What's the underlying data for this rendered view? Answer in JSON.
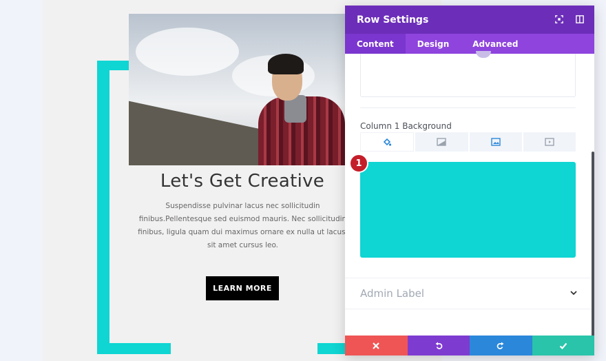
{
  "page": {
    "headline": "Let's Get Creative",
    "body_text": "Suspendisse pulvinar lacus nec sollicitudin finibus.Pellentesque sed euismod mauris. Nec sollicitudin finibus, ligula quam dui maximus ornare ex nulla ut lacus, sit amet cursus leo.",
    "cta_label": "LEARN MORE",
    "accent_color": "#0fd5d3"
  },
  "panel": {
    "title": "Row Settings",
    "header_icons": [
      "fullscreen-icon",
      "sidebar-toggle-icon"
    ],
    "tabs": [
      {
        "label": "Content",
        "active": true
      },
      {
        "label": "Design",
        "active": false
      },
      {
        "label": "Advanced",
        "active": false
      }
    ],
    "background_field": {
      "label": "Column 1 Background",
      "type_tabs": [
        "color-icon",
        "gradient-icon",
        "image-icon",
        "video-icon"
      ],
      "active_type": "color",
      "color_value": "#0fd5d3",
      "badge": "1"
    },
    "admin_label": "Admin Label",
    "footer_buttons": [
      "close-icon",
      "undo-icon",
      "redo-icon",
      "check-icon"
    ],
    "colors": {
      "header": "#6c2eb9",
      "tabs": "#8e44dd",
      "cancel": "#ef5555",
      "undo": "#7e3bd0",
      "redo": "#2b87da",
      "save": "#29c4a9"
    }
  }
}
